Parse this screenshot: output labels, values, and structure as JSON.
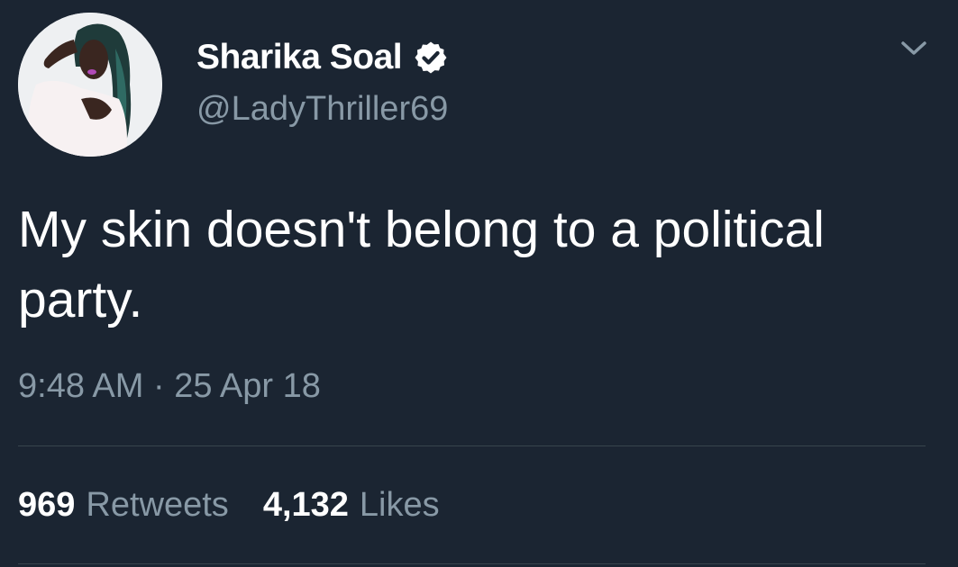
{
  "author": {
    "display_name": "Sharika Soal",
    "handle": "@LadyThriller69",
    "verified": true
  },
  "tweet": {
    "text": "My skin doesn't belong to a political party.",
    "time": "9:48 AM",
    "separator": "·",
    "date": "25 Apr 18"
  },
  "stats": {
    "retweets_count": "969",
    "retweets_label": "Retweets",
    "likes_count": "4,132",
    "likes_label": "Likes"
  },
  "icons": {
    "verified": "verified-badge-icon",
    "menu": "chevron-down-icon"
  },
  "colors": {
    "background": "#1b2532",
    "primary_text": "#ffffff",
    "secondary_text": "#8899a6",
    "divider": "#38444d"
  }
}
